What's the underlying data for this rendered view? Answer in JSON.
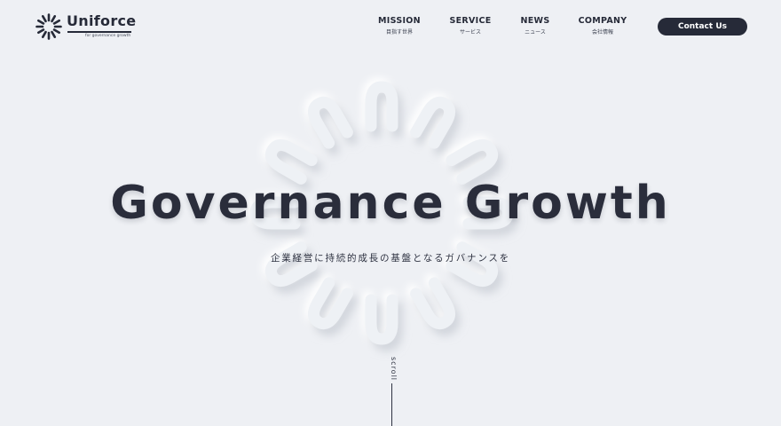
{
  "header": {
    "logo": {
      "wordmark": "Uniforce",
      "tagline": "for governance growth"
    },
    "nav": [
      {
        "label": "MISSION",
        "sub": "目指す世界"
      },
      {
        "label": "SERVICE",
        "sub": "サービス"
      },
      {
        "label": "NEWS",
        "sub": "ニュース"
      },
      {
        "label": "COMPANY",
        "sub": "会社情報"
      }
    ],
    "contact_label": "Contact Us"
  },
  "hero": {
    "title": "Governance Growth",
    "subtitle": "企業経営に持続的成長の基盤となるガバナンスを",
    "scroll_label": "scroll"
  },
  "colors": {
    "background": "#eef0f4",
    "primary": "#262a38"
  }
}
